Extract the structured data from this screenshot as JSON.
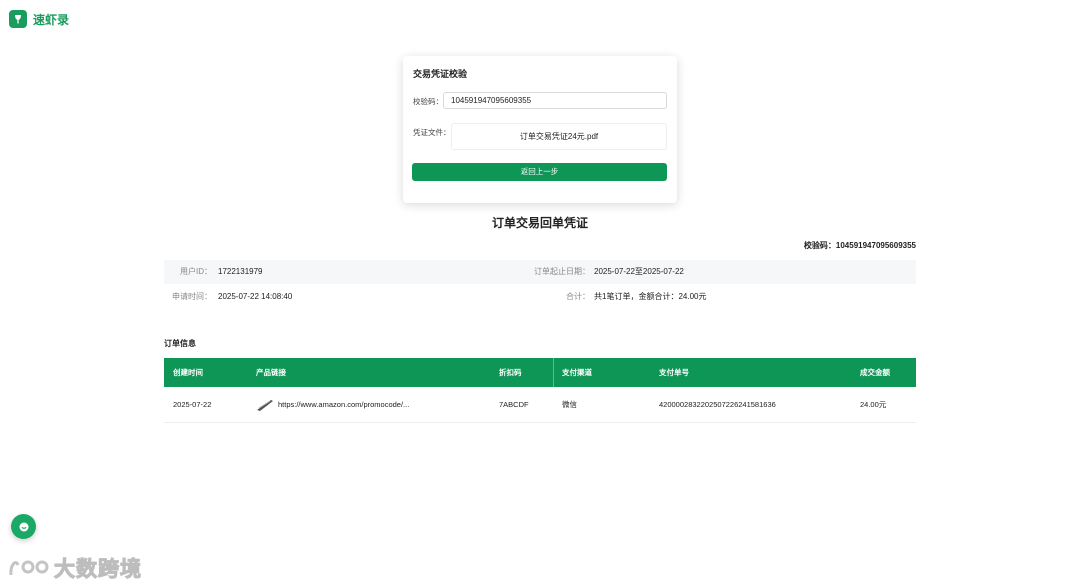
{
  "brand": {
    "name": "速虾录",
    "logo_icon": "leaf-icon",
    "color": "#1a9c5c"
  },
  "verify_card": {
    "title": "交易凭证校验",
    "code_label": "校验码：",
    "code_value": "104591947095609355",
    "file_label": "凭证文件：",
    "file_name": "订单交易凭证24元.pdf",
    "back_button": "返回上一步"
  },
  "document": {
    "title": "订单交易回单凭证",
    "verify_code_text": "校验码：104591947095609355",
    "info": {
      "user_id_label": "用户ID：",
      "user_id": "1722131979",
      "date_range_label": "订单起止日期：",
      "date_range": "2025-07-22至2025-07-22",
      "apply_time_label": "申请时间：",
      "apply_time": "2025-07-22 14:08:40",
      "total_label": "合计：",
      "total": "共1笔订单，金额合计：24.00元"
    },
    "section_title": "订单信息",
    "table": {
      "headers": [
        "创建时间",
        "产品链接",
        "折扣码",
        "支付渠道",
        "支付单号",
        "成交金额"
      ],
      "rows": [
        {
          "created": "2025-07-22",
          "link": "https://www.amazon.com/promocode/...",
          "discount_code": "7ABCDF",
          "channel": "微信",
          "pay_no": "4200002832202507226241581636",
          "amount": "24.00元"
        }
      ]
    }
  },
  "floating": {
    "chat_icon": "chat-icon"
  },
  "watermark": {
    "text": "大数跨境"
  },
  "colors": {
    "primary": "#0e9657",
    "accent": "#1a9c5c"
  }
}
